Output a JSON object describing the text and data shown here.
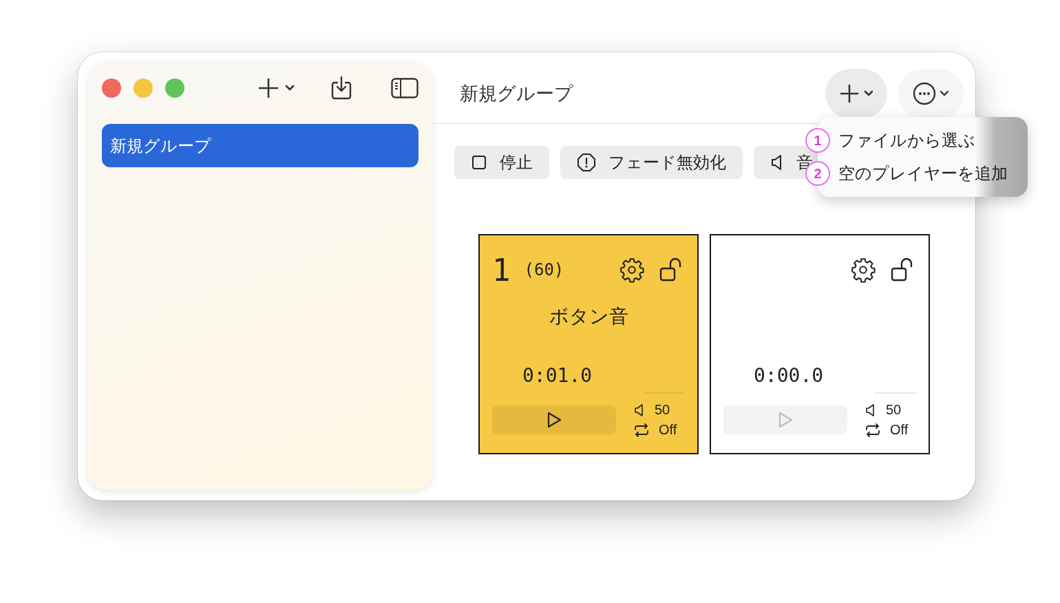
{
  "window": {
    "title": "新規グループ"
  },
  "sidebar": {
    "items": [
      {
        "label": "新規グループ",
        "selected": true
      }
    ]
  },
  "toolbar": [
    {
      "label": "停止",
      "kind": "stop"
    },
    {
      "label": "フェード無効化",
      "kind": "fade"
    },
    {
      "label": "音",
      "kind": "volume"
    }
  ],
  "menu": {
    "items": [
      {
        "marker": "1",
        "label": "ファイルから選ぶ"
      },
      {
        "marker": "2",
        "label": "空のプレイヤーを追加"
      }
    ]
  },
  "players": [
    {
      "number": "1",
      "count": "(60)",
      "name": "ボタン音",
      "time": "0:01.0",
      "volume": "50",
      "loop": "Off",
      "active": true
    },
    {
      "time": "0:00.0",
      "volume": "50",
      "loop": "Off",
      "active": false
    }
  ]
}
